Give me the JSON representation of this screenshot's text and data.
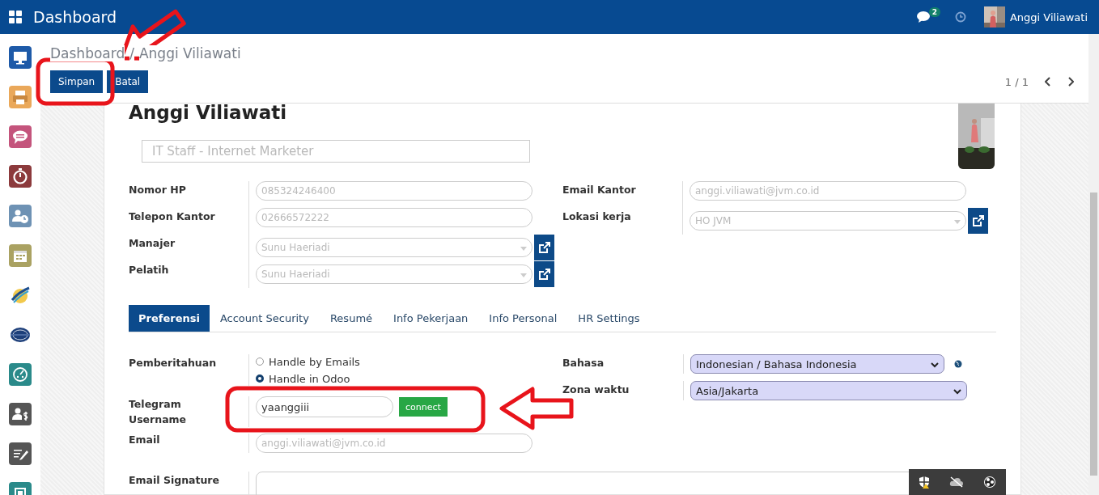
{
  "topbar": {
    "title": "Dashboard",
    "messages_badge": "2",
    "user_name": "Anggi Viliawati"
  },
  "sidebar": {
    "apps": [
      {
        "kind": "monitor"
      },
      {
        "kind": "printer"
      },
      {
        "kind": "chat"
      },
      {
        "kind": "stopwatch"
      },
      {
        "kind": "user-clock"
      },
      {
        "kind": "calendar"
      },
      {
        "kind": "swirl"
      },
      {
        "kind": "badge"
      },
      {
        "kind": "gauge"
      },
      {
        "kind": "user-dollar"
      },
      {
        "kind": "pen"
      },
      {
        "kind": "square"
      }
    ]
  },
  "breadcrumb": [
    "Dashboard",
    "/",
    "Anggi Viliawati"
  ],
  "buttons": [
    "Simpan",
    "Batal"
  ],
  "pager": {
    "text": "1 / 1"
  },
  "form": {
    "name": "Anggi Viliawati",
    "job_title": "IT Staff - Internet Marketer",
    "left_fields": [
      {
        "label": "Nomor HP",
        "value": "085324246400",
        "kind": "text"
      },
      {
        "label": "Telepon Kantor",
        "value": "02666572222",
        "kind": "text"
      },
      {
        "label": "Manajer",
        "value": "Sunu Haeriadi",
        "kind": "many2one"
      },
      {
        "label": "Pelatih",
        "value": "Sunu Haeriadi",
        "kind": "many2one"
      }
    ],
    "right_fields": [
      {
        "label": "Email Kantor",
        "value": "anggi.viliawati@jvm.co.id",
        "kind": "text"
      },
      {
        "label": "Lokasi kerja",
        "value": "HO JVM",
        "kind": "many2one"
      }
    ]
  },
  "tabs": [
    {
      "label": "Preferensi",
      "selected": true
    },
    {
      "label": "Account Security",
      "selected": false
    },
    {
      "label": "Resumé",
      "selected": false
    },
    {
      "label": "Info Pekerjaan",
      "selected": false
    },
    {
      "label": "Info Personal",
      "selected": false
    },
    {
      "label": "HR Settings",
      "selected": false
    }
  ],
  "preferences": {
    "notification_label": "Pemberitahuan",
    "notification_options": [
      {
        "label": "Handle by Emails",
        "selected": false
      },
      {
        "label": "Handle in Odoo",
        "selected": true
      }
    ],
    "telegram_label": "Telegram Username",
    "telegram_value": "yaanggiii",
    "connect_button": "connect",
    "email_label": "Email",
    "email_value": "anggi.viliawati@jvm.co.id",
    "language_label": "Bahasa",
    "language_value": "Indonesian / Bahasa Indonesia",
    "timezone_label": "Zona waktu",
    "timezone_value": "Asia/Jakarta",
    "signature_label": "Email Signature"
  }
}
